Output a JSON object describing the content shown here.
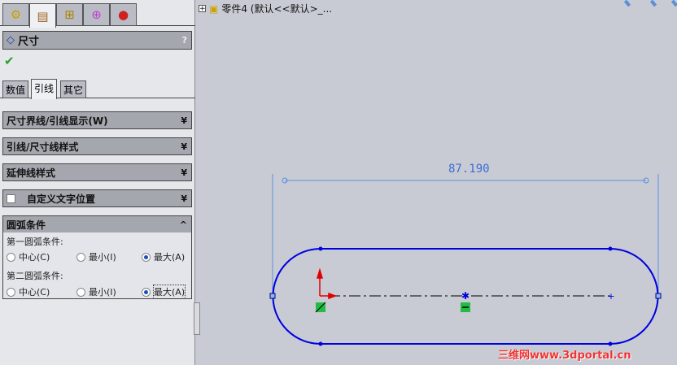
{
  "panel": {
    "tabs": [
      {
        "icon": "feature-manager-icon"
      },
      {
        "icon": "property-manager-icon"
      },
      {
        "icon": "configuration-manager-icon"
      },
      {
        "icon": "dimxpert-icon"
      },
      {
        "icon": "display-manager-icon"
      }
    ],
    "title": "尺寸",
    "help": "?",
    "ok": "✔",
    "prop_tabs": [
      "数值",
      "引线",
      "其它"
    ],
    "sections": [
      "尺寸界线/引线显示(W)",
      "引线/尺寸线样式",
      "延伸线样式",
      "自定义文字位置",
      "圆弧条件"
    ],
    "arc": {
      "first_label": "第一圆弧条件:",
      "second_label": "第二圆弧条件:",
      "options": [
        "中心(C)",
        "最小(I)",
        "最大(A)"
      ],
      "first_selected": "最大(A)",
      "second_selected": "最大(A)"
    }
  },
  "tree": {
    "expander": "+",
    "label": "零件4  (默认<<默认>_..."
  },
  "drawing": {
    "dimension": "87.190",
    "line_color": "#0000e0",
    "dim_color": "#3a6fd8"
  },
  "watermark": "三维网www.3dportal.cn"
}
